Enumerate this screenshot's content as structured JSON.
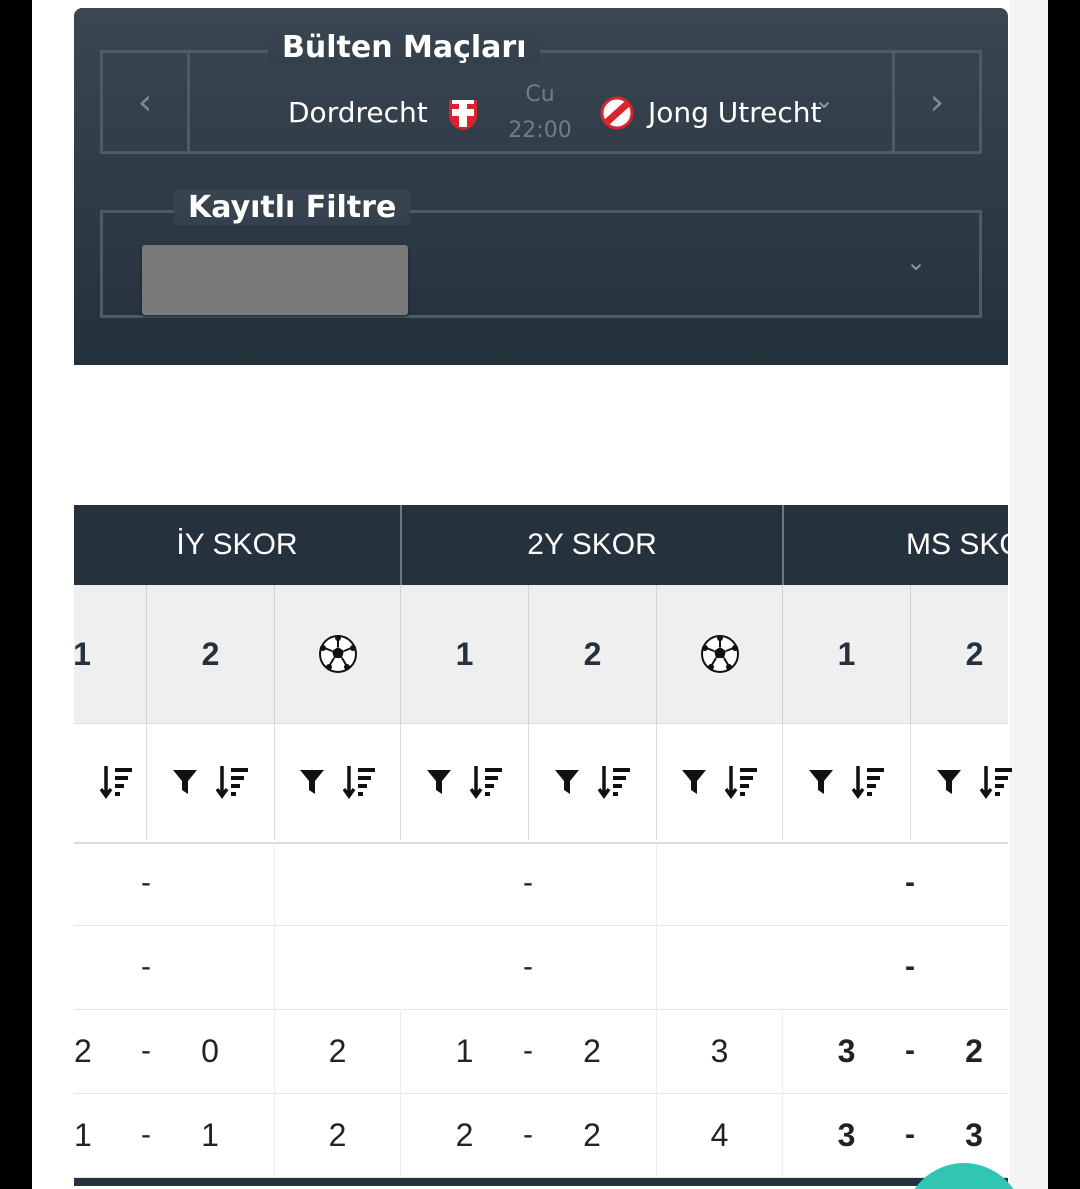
{
  "filter_panel": {
    "fixtures_legend": "Bülten Maçları",
    "home_team": "Dordrecht",
    "away_team": "Jong Utrecht",
    "match_day": "Cu",
    "match_time": "22:00",
    "saved_filter_legend": "Kayıtlı Filtre",
    "prev_icon": "‹",
    "next_icon": "›",
    "dropdown_icon": "⌄"
  },
  "table": {
    "groups": [
      "İY SKOR",
      "2Y SKOR",
      "MS SKOR"
    ],
    "sub_headers": [
      "1",
      "2",
      "⚽",
      "1",
      "2",
      "⚽",
      "1",
      "2"
    ],
    "controls": {
      "filter_icon": "filter-icon",
      "sort_icon": "sort-icon"
    },
    "rows": [
      {
        "iy_home": "",
        "iy_away": "",
        "iy_total": "",
        "y2_home": "",
        "y2_away": "",
        "y2_total": "",
        "ms_home": "",
        "ms_away": ""
      },
      {
        "iy_home": "",
        "iy_away": "",
        "iy_total": "",
        "y2_home": "",
        "y2_away": "",
        "y2_total": "",
        "ms_home": "",
        "ms_away": ""
      },
      {
        "iy_home": "2",
        "iy_away": "0",
        "iy_total": "2",
        "y2_home": "1",
        "y2_away": "2",
        "y2_total": "3",
        "ms_home": "3",
        "ms_away": "2"
      },
      {
        "iy_home": "1",
        "iy_away": "1",
        "iy_total": "2",
        "y2_home": "2",
        "y2_away": "2",
        "y2_total": "4",
        "ms_home": "3",
        "ms_away": "3"
      }
    ],
    "separator": "-"
  }
}
